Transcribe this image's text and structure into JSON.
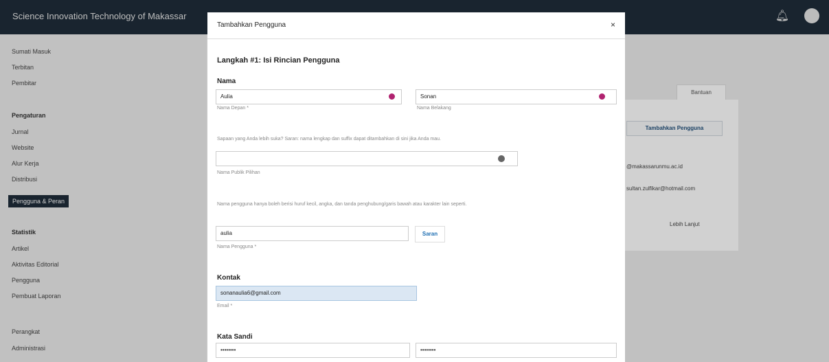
{
  "topbar": {
    "brand": "Science Innovation Technology of Makassar"
  },
  "sidebar": {
    "items_top": [
      "Sumati Masuk",
      "Terbitan",
      "Pembitar"
    ],
    "section_pengaturan": "Pengaturan",
    "items_pengaturan": [
      "Jurnal",
      "Website",
      "Alur Kerja",
      "Distribusi"
    ],
    "active_item": "Pengguna & Peran",
    "section_statistik": "Statistik",
    "items_statistik": [
      "Artikel",
      "Aktivitas Editorial",
      "Pengguna",
      "Pembuat Laporan"
    ],
    "section_other": [
      "Perangkat",
      "Administrasi"
    ]
  },
  "background": {
    "tab": "Bantuan",
    "button": "Tambahkan Pengguna",
    "line1": "@makassarunmu.ac.id",
    "line2": "sultan.zulfikar@hotmail.com",
    "line3": "Lebih Lanjut"
  },
  "modal": {
    "title": "Tambahkan Pengguna",
    "close": "×",
    "step_title": "Langkah #1: Isi Rincian Pengguna",
    "nama": {
      "label": "Nama",
      "first_value": "Aulia",
      "first_help": "Nama Depan *",
      "last_value": "Sonan",
      "last_help": "Nama Belakang"
    },
    "pref_desc": "Sapaan yang Anda lebih suka? Saran: nama lengkap dan suffix dapat ditambahkan di sini jika Anda mau.",
    "pref_help": "Nama Publik Pilihan",
    "username_desc": "Nama pengguna hanya boleh berisi huruf kecil, angka, dan tanda penghubung/garis bawah atau karakter lain seperti.",
    "username_value": "aulia",
    "username_help": "Nama Pengguna *",
    "suggest_label": "Saran",
    "kontak": {
      "label": "Kontak",
      "email_value": "sonanaulia6@gmail.com",
      "email_help": "Email *"
    },
    "password": {
      "label": "Kata Sandi",
      "value1": "••••••••",
      "value2": "••••••••"
    }
  }
}
